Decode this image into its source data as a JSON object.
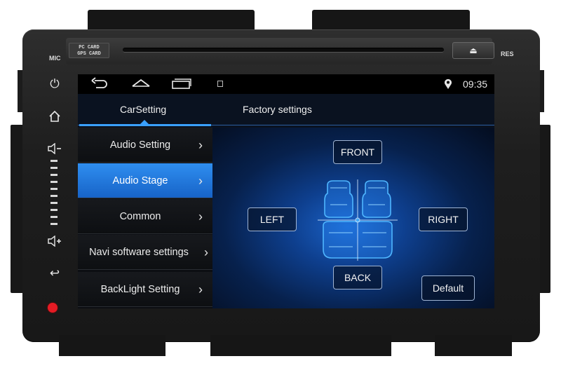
{
  "hardware": {
    "mic_label": "MIC",
    "res_label": "RES",
    "sd_slot_label_1": "PC CARD",
    "sd_slot_label_2": "GPS CARD",
    "eject_symbol": "⏏",
    "record_color": "#e51b24"
  },
  "side_buttons": {
    "power_icon": "power-icon",
    "home_icon": "home-icon",
    "volume_down_icon": "volume-down-icon",
    "volume_up_icon": "volume-up-icon",
    "back_icon": "back-arrow-icon",
    "power_glyph": "⏻",
    "home_glyph": "⌂",
    "vol_down_glyph": "◁−",
    "vol_up_glyph": "◁+",
    "back_glyph": "↩"
  },
  "statusbar": {
    "back_glyph": "↩",
    "time": "09:35"
  },
  "tabs": [
    {
      "label": "CarSetting",
      "active": true
    },
    {
      "label": "Factory settings",
      "active": false
    }
  ],
  "menu": [
    {
      "label": "Audio Setting",
      "active": false
    },
    {
      "label": "Audio Stage",
      "active": true
    },
    {
      "label": "Common",
      "active": false
    },
    {
      "label": "Navi software settings",
      "active": false
    },
    {
      "label": "BackLight Setting",
      "active": false
    }
  ],
  "menu_chevron": "›",
  "stage": {
    "front_label": "FRONT",
    "left_label": "LEFT",
    "right_label": "RIGHT",
    "back_label": "BACK",
    "default_label": "Default"
  },
  "colors": {
    "accent": "#3aa0ff",
    "active_menu": "#2f8ef0",
    "seat_outline": "#4fb6ff"
  }
}
